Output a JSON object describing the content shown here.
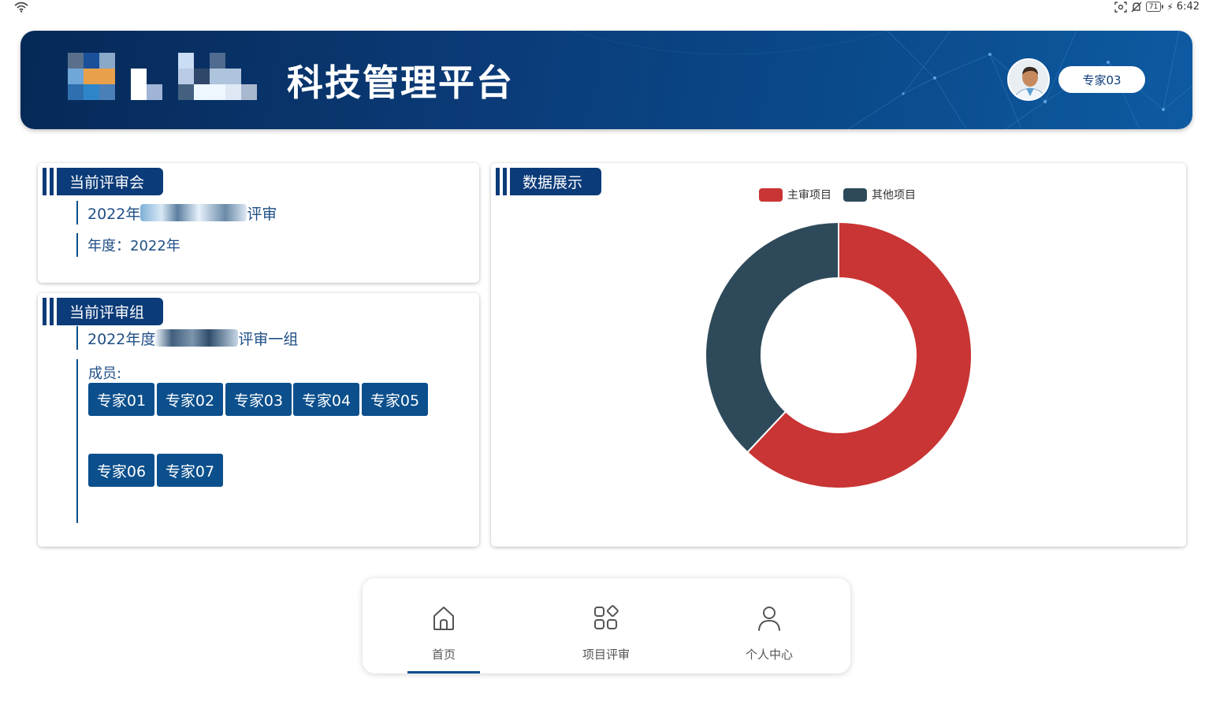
{
  "status_bar": {
    "battery": "71",
    "time": "6:42",
    "icons": [
      "wifi-icon",
      "screenshot-icon",
      "mute-bell-icon",
      "battery-icon",
      "charging-icon"
    ]
  },
  "header": {
    "title": "科技管理平台",
    "user_name": "专家03"
  },
  "meeting_card": {
    "tab_label": "当前评审会",
    "meeting_name_prefix": "2022年",
    "meeting_name_suffix": "评审",
    "year_line": "年度：2022年"
  },
  "group_card": {
    "tab_label": "当前评审组",
    "group_name_prefix": "2022年度",
    "group_name_suffix": "评审一组",
    "members_label": "成员:",
    "members": [
      "专家01",
      "专家02",
      "专家03",
      "专家04",
      "专家05",
      "专家06",
      "专家07"
    ]
  },
  "chart_card": {
    "tab_label": "数据展示"
  },
  "chart_data": {
    "type": "pie",
    "donut": true,
    "categories": [
      "主审项目",
      "其他项目"
    ],
    "values": [
      62,
      38
    ],
    "colors": [
      "#c93434",
      "#2e4a5a"
    ],
    "legend_position": "top-center"
  },
  "bottom_nav": {
    "items": [
      {
        "label": "首页",
        "icon": "home-icon",
        "active": true
      },
      {
        "label": "项目评审",
        "icon": "apps-grid-icon",
        "active": false
      },
      {
        "label": "个人中心",
        "icon": "person-icon",
        "active": false
      }
    ]
  },
  "colors": {
    "primary": "#0b3b78",
    "chip": "#0b4f8c",
    "series_main": "#c93434",
    "series_other": "#2e4a5a"
  }
}
